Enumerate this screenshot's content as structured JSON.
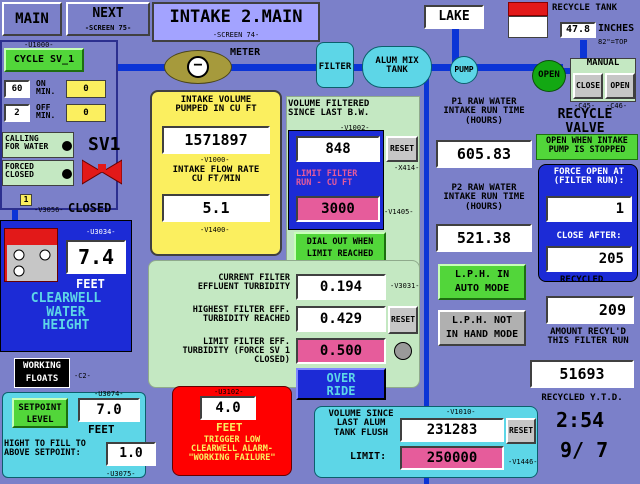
{
  "nav": {
    "main": "MAIN",
    "next": "NEXT",
    "next_sub": "-SCREEN 75-",
    "title": "INTAKE 2.MAIN",
    "title_sub": "-SCREEN 74-"
  },
  "top": {
    "lake": "LAKE",
    "meter": "METER",
    "filter": "FILTER",
    "alum_tank": "ALUM MIX\nTANK",
    "pump": "PUMP",
    "recycle_tank": "RECYCLE TANK",
    "recycle_inches_value": "47.8",
    "recycle_inches": "INCHES",
    "recycle_top": "82\"=TOP",
    "open_label": "OPEN",
    "manual": "MANUAL",
    "close_btn": "CLOSE",
    "open_btn": "OPEN",
    "c45": "-C45-",
    "c46": "-C46-",
    "recycle_valve": "RECYCLE\nVALVE",
    "open_when": "OPEN WHEN INTAKE\nPUMP IS STOPPED"
  },
  "cycle": {
    "tag": "-U1000-",
    "button": "CYCLE SV_1",
    "on_val": "60",
    "on_label": "ON\nMIN.",
    "on_out": "0",
    "off_val": "2",
    "off_label": "OFF\nMIN.",
    "off_out": "0",
    "calling": "CALLING\nFOR WATER",
    "forced": "FORCED\nCLOSED",
    "sv1": "SV1",
    "closed": "CLOSED",
    "v3056": "-V3056-",
    "one": "1"
  },
  "intake": {
    "title": "INTAKE VOLUME\nPUMPED IN CU FT",
    "volume": "1571897",
    "v1000": "-V1000-",
    "flow_title": "INTAKE FLOW RATE\nCU FT/MIN",
    "flow": "5.1",
    "v1400": "-V1400-"
  },
  "filtered": {
    "title": "VOLUME FILTERED\nSINCE LAST B.W.",
    "v1002": "-V1002-",
    "value": "848",
    "reset": "RESET",
    "x414": "-X414-",
    "limit_title": "LIMIT FILTER\nRUN - CU FT",
    "limit": "3000",
    "v1405": "-V1405-",
    "dial_out": "DIAL OUT WHEN\nLIMIT REACHED"
  },
  "runtime": {
    "p1_title": "P1 RAW WATER\nINTAKE RUN TIME\n(HOURS)",
    "p1": "605.83",
    "p2_title": "P2 RAW WATER\nINTAKE RUN TIME\n(HOURS)",
    "p2": "521.38",
    "lph_auto": "L.P.H. IN\nAUTO MODE",
    "lph_hand": "L.P.H. NOT\nIN HAND MODE"
  },
  "forceopen": {
    "title": "FORCE OPEN AT\n(FILTER RUN):",
    "value": "1",
    "close_after": "CLOSE AFTER:",
    "close_value": "205",
    "recycled": "RECYCLED",
    "amount": "209",
    "amount_label": "AMOUNT RECYL'D\nTHIS FILTER RUN",
    "ytd": "51693",
    "ytd_label": "RECYCLED Y.T.D."
  },
  "clearwell": {
    "tag": "-U3034-",
    "value": "7.4",
    "feet": "FEET",
    "title": "CLEARWELL\nWATER\nHEIGHT"
  },
  "turbidity": {
    "current_title": "CURRENT FILTER\nEFFLUENT TURBIDITY",
    "current": "0.194",
    "v3031": "-V3031-",
    "highest_title": "HIGHEST FILTER EFF.\nTURBIDITY REACHED",
    "highest": "0.429",
    "reset": "RESET",
    "limit_title": "LIMIT FILTER EFF.\nTURBIDITY (FORCE SV 1\nCLOSED)",
    "limit": "0.500",
    "override": "OVER\nRIDE"
  },
  "floats": {
    "working": "WORKING\nFLOATS",
    "c2": "-C2-",
    "setpoint": "SETPOINT\nLEVEL",
    "u3074": "-U3074-",
    "setpoint_value": "7.0",
    "feet": "FEET",
    "hight": "HIGHT TO FILL TO\nABOVE SETPOINT:",
    "hight_value": "1.0",
    "u3075": "-U3075-"
  },
  "alarm": {
    "tag": "-U3102-",
    "value": "4.0",
    "feet": "FEET",
    "text": "TRIGGER LOW\nCLEARWELL ALARM-\n\"WORKING FAILURE\""
  },
  "alum": {
    "v1010": "-V1010-",
    "title": "VOLUME SINCE\nLAST ALUM\nTANK FLUSH",
    "value": "231283",
    "reset": "RESET",
    "limit_label": "LIMIT:",
    "limit": "250000",
    "v1446": "-V1446-"
  },
  "clock": {
    "time": "2:54",
    "date": "9/ 7"
  },
  "colors": {
    "pipe": "#0b34d6",
    "panel_yellow": "#fbef5f",
    "panel_green": "#c4e8c2",
    "panel_cyan": "#5dd6e7",
    "alarm_red": "#ff0000",
    "valve_red": "#e21919"
  }
}
